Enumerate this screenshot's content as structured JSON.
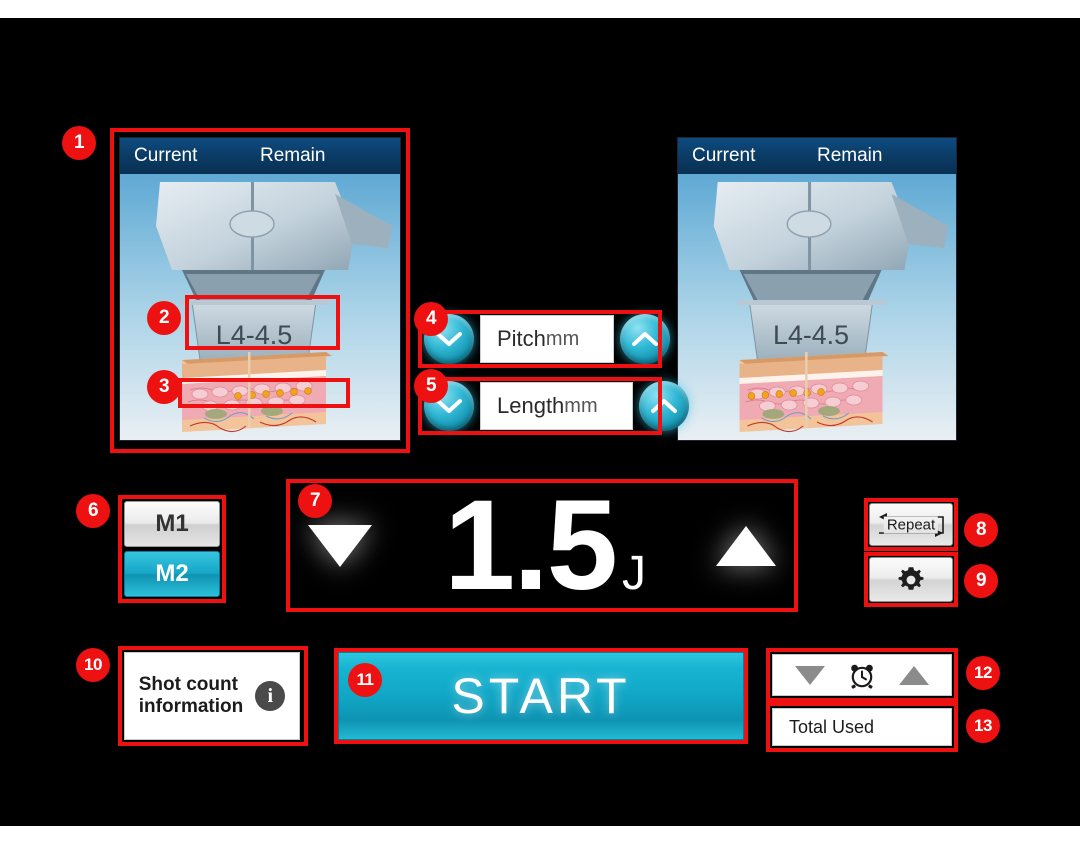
{
  "device": {
    "screen_background": "#000000",
    "accent_color": "#17b4d2",
    "annotation_color": "#ee1111"
  },
  "panels": {
    "left": {
      "header_current": "Current",
      "header_remain": "Remain",
      "cartridge_label": "L4-4.5"
    },
    "right": {
      "header_current": "Current",
      "header_remain": "Remain",
      "cartridge_label": "L4-4.5"
    }
  },
  "parameters": {
    "pitch": {
      "label": "Pitch",
      "unit": "mm",
      "decrease_icon": "chevron-down-icon",
      "increase_icon": "chevron-up-icon"
    },
    "length": {
      "label": "Length",
      "unit": "mm",
      "decrease_icon": "chevron-down-icon",
      "increase_icon": "chevron-up-icon"
    }
  },
  "memory": {
    "m1_label": "M1",
    "m2_label": "M2",
    "selected": "M2"
  },
  "energy": {
    "value": "1.5",
    "unit": "J",
    "decrease_icon": "triangle-down-icon",
    "increase_icon": "triangle-up-icon"
  },
  "side_buttons": {
    "repeat_label": "Repeat",
    "repeat_icon": "repeat-loop-icon",
    "settings_icon": "gear-icon"
  },
  "bottom": {
    "shot_count_line1": "Shot count",
    "shot_count_line2": "information",
    "info_icon": "info-icon",
    "start_label": "START",
    "timer_icon": "alarm-clock-icon",
    "timer_decrease_icon": "triangle-down-icon",
    "timer_increase_icon": "triangle-up-icon",
    "total_used_label": "Total Used"
  },
  "annotations": [
    {
      "id": "1",
      "target": "left-treatment-panel"
    },
    {
      "id": "2",
      "target": "cartridge-label-highlight"
    },
    {
      "id": "3",
      "target": "treatment-depth-highlight"
    },
    {
      "id": "4",
      "target": "pitch-row"
    },
    {
      "id": "5",
      "target": "length-row"
    },
    {
      "id": "6",
      "target": "memory-buttons"
    },
    {
      "id": "7",
      "target": "energy-display"
    },
    {
      "id": "8",
      "target": "repeat-button"
    },
    {
      "id": "9",
      "target": "settings-button"
    },
    {
      "id": "10",
      "target": "shot-count-information-button"
    },
    {
      "id": "11",
      "target": "start-button"
    },
    {
      "id": "12",
      "target": "timer-stepper"
    },
    {
      "id": "13",
      "target": "total-used-field"
    }
  ]
}
